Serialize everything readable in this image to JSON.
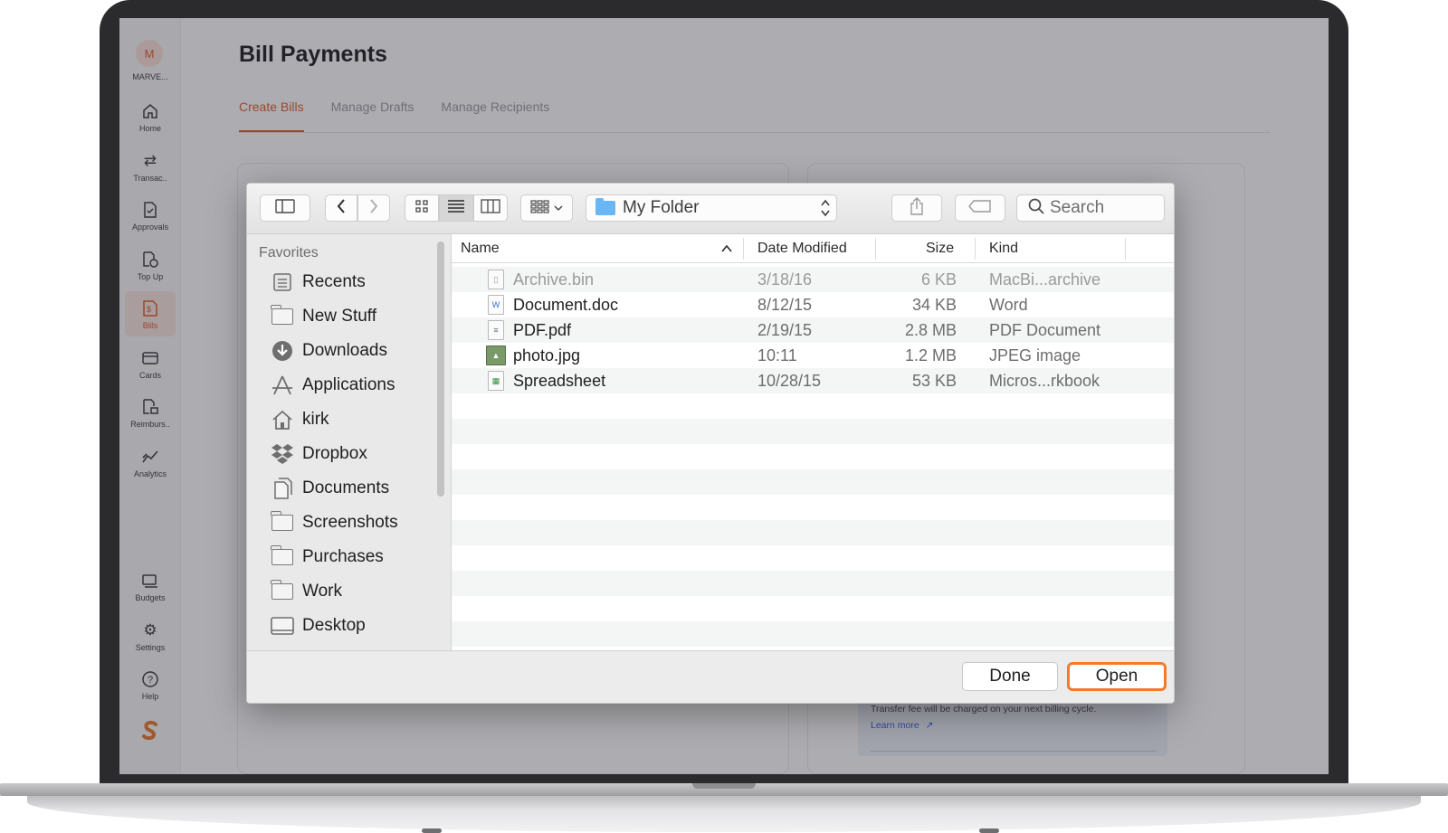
{
  "app": {
    "org_initial": "M",
    "org_name": "MARVE...",
    "page_title": "Bill Payments",
    "tabs": [
      {
        "label": "Create Bills",
        "active": true
      },
      {
        "label": "Manage Drafts",
        "active": false
      },
      {
        "label": "Manage Recipients",
        "active": false
      }
    ],
    "nav": [
      {
        "label": "Home",
        "icon": "home-icon"
      },
      {
        "label": "Transac..",
        "icon": "transfer-arrows-icon"
      },
      {
        "label": "Approvals",
        "icon": "document-check-icon"
      },
      {
        "label": "Top Up",
        "icon": "top-up-icon"
      },
      {
        "label": "Bills",
        "icon": "bill-icon",
        "active": true
      },
      {
        "label": "Cards",
        "icon": "card-icon"
      },
      {
        "label": "Reimburs..",
        "icon": "reimburse-icon"
      },
      {
        "label": "Analytics",
        "icon": "analytics-icon"
      }
    ],
    "nav_bottom": [
      {
        "label": "Budgets",
        "icon": "budget-icon"
      },
      {
        "label": "Settings",
        "icon": "gear-icon"
      },
      {
        "label": "Help",
        "icon": "help-icon"
      }
    ],
    "fee_note": "Transfer fee will be charged on your next billing cycle.",
    "learn_more": "Learn more",
    "accent_color": "#e25b2c"
  },
  "dialog": {
    "location": "My Folder",
    "search_placeholder": "Search",
    "favorites_title": "Favorites",
    "favorites": [
      {
        "label": "Recents",
        "icon": "recents-icon"
      },
      {
        "label": "New Stuff",
        "icon": "folder-icon"
      },
      {
        "label": "Downloads",
        "icon": "downloads-icon"
      },
      {
        "label": "Applications",
        "icon": "applications-icon"
      },
      {
        "label": "kirk",
        "icon": "home-icon"
      },
      {
        "label": "Dropbox",
        "icon": "dropbox-icon"
      },
      {
        "label": "Documents",
        "icon": "documents-icon"
      },
      {
        "label": "Screenshots",
        "icon": "folder-icon"
      },
      {
        "label": "Purchases",
        "icon": "folder-icon"
      },
      {
        "label": "Work",
        "icon": "folder-icon"
      },
      {
        "label": "Desktop",
        "icon": "desktop-icon"
      }
    ],
    "columns": {
      "name": "Name",
      "date": "Date Modified",
      "size": "Size",
      "kind": "Kind"
    },
    "files": [
      {
        "name": "Archive.bin",
        "date": "3/18/16",
        "size": "6 KB",
        "kind": "MacBi...archive",
        "dimmed": true
      },
      {
        "name": "Document.doc",
        "date": "8/12/15",
        "size": "34 KB",
        "kind": "Word"
      },
      {
        "name": "PDF.pdf",
        "date": "2/19/15",
        "size": "2.8 MB",
        "kind": "PDF Document"
      },
      {
        "name": "photo.jpg",
        "date": "10:11",
        "size": "1.2 MB",
        "kind": "JPEG image"
      },
      {
        "name": "Spreadsheet",
        "date": "10/28/15",
        "size": "53 KB",
        "kind": "Micros...rkbook"
      }
    ],
    "done_label": "Done",
    "open_label": "Open",
    "open_highlight_color": "#f47a2b"
  }
}
